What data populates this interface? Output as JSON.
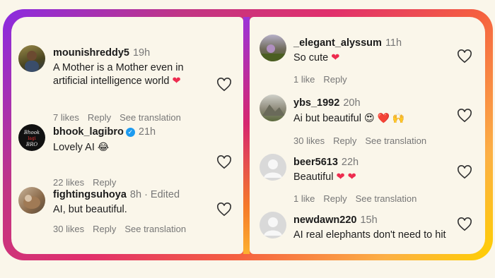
{
  "left": {
    "comments": [
      {
        "username": "mounishreddy5",
        "time": "19h",
        "text_line1": "A Mother is a Mother even in",
        "text_line2": "artificial intelligence world",
        "emoji": "❤️",
        "likes": "7 likes",
        "reply": "Reply",
        "translate": "See translation"
      },
      {
        "username": "bhook_lagibro",
        "time": "21h",
        "text": "Lovely AI",
        "emoji": "😂",
        "likes": "22 likes",
        "reply": "Reply",
        "avatar_text": "BHOOK LAGI BRO"
      },
      {
        "username": "fightingsuhoya",
        "time": "8h · Edited",
        "text": "AI, but beautiful.",
        "likes": "30 likes",
        "reply": "Reply",
        "translate": "See translation"
      }
    ]
  },
  "right": {
    "comments": [
      {
        "username": "_elegant_alyssum",
        "time": "11h",
        "text": "So cute",
        "emoji": "❤️",
        "likes": "1 like",
        "reply": "Reply"
      },
      {
        "username": "ybs_1992",
        "time": "20h",
        "text": "Ai but beautiful",
        "emoji": "😍 ❤️ 🙌",
        "likes": "30 likes",
        "reply": "Reply",
        "translate": "See translation"
      },
      {
        "username": "beer5613",
        "time": "22h",
        "text": "Beautiful",
        "emoji": "❤️ ❤️",
        "likes": "1 like",
        "reply": "Reply",
        "translate": "See translation"
      },
      {
        "username": "newdawn220",
        "time": "15h",
        "text": "AI real elephants don't need to hit"
      }
    ]
  },
  "colors": {
    "heart_red": "#ed2c4f",
    "verified_blue": "#1d9bf0",
    "background": "#faf6ea"
  }
}
